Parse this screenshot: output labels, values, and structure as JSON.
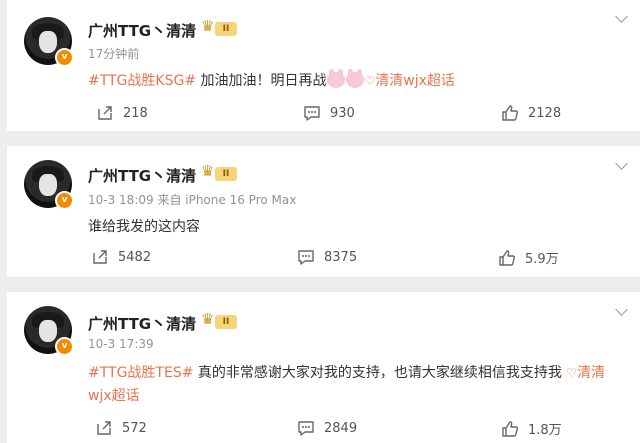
{
  "posts": [
    {
      "author": "广州TTG丶清清",
      "vip_level": "II",
      "time": "17分钟前",
      "tag": "#TTG战胜KSG#",
      "text": " 加油加油！明日再战",
      "emojis": [
        "bunny-emoji",
        "bunny-emoji"
      ],
      "super_topic": "清清wjx超话",
      "reposts": "218",
      "comments": "930",
      "likes": "2128"
    },
    {
      "author": "广州TTG丶清清",
      "vip_level": "II",
      "time": "10-3 18:09 来自 iPhone 16 Pro Max",
      "text": "谁给我发的这内容",
      "reposts": "5482",
      "comments": "8375",
      "likes": "5.9万"
    },
    {
      "author": "广州TTG丶清清",
      "vip_level": "II",
      "time": "10-3 17:39",
      "tag": "#TTG战胜TES#",
      "text": " 真的非常感谢大家对我的支持，也请大家继续相信我支持我 ",
      "super_topic": "清清wjx超话",
      "reposts": "572",
      "comments": "2849",
      "likes": "1.8万"
    }
  ],
  "colors": {
    "accent": "#eb7350",
    "vip": "#f6d57a",
    "avatar_badge": "#f58a00"
  }
}
